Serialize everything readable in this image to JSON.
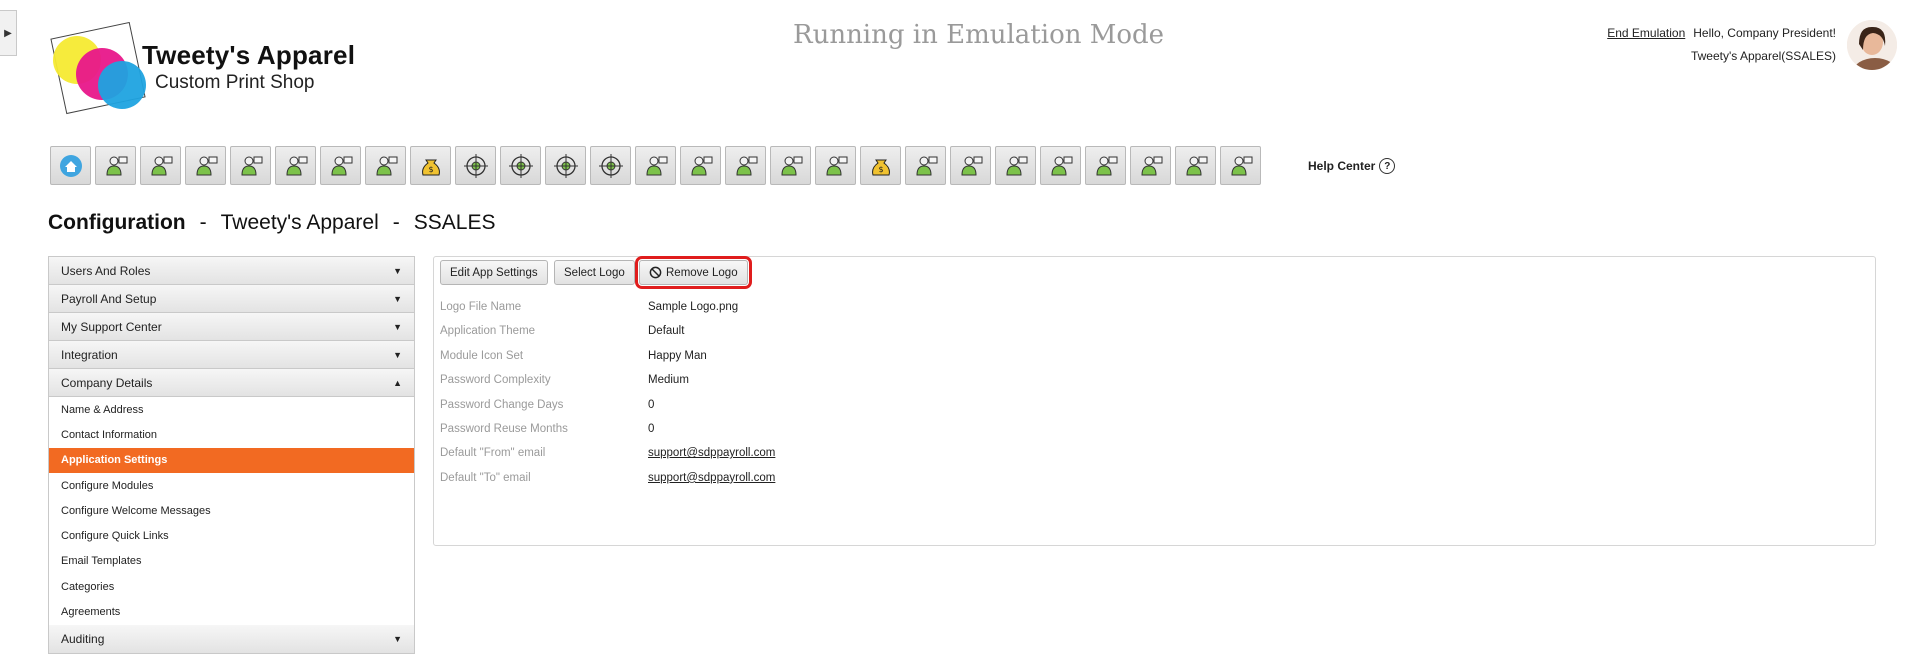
{
  "brand": {
    "name": "Tweety's Apparel",
    "tagline": "Custom Print Shop",
    "colors": {
      "yellow": "#f6ea32",
      "magenta": "#e8178a",
      "cyan": "#1fa3e0"
    }
  },
  "header": {
    "emulation_text": "Running in Emulation Mode",
    "end_emulation": "End Emulation",
    "greeting": "Hello, Company President!",
    "company": "Tweety's Apparel(SSALES)"
  },
  "toolbar": {
    "icons": [
      "home-icon",
      "award-icon",
      "settings-person-icon",
      "presenter-icon",
      "team-icon",
      "group-board-icon",
      "org-chart-icon",
      "document-icon",
      "money-bag-icon",
      "target-icon",
      "target-icon",
      "target-icon",
      "target-icon",
      "team-chart-icon",
      "person-idea-icon",
      "shield-lock-icon",
      "payment-hand-icon",
      "person-cancel-icon",
      "money-bag-icon",
      "team-money-icon",
      "person-idea-icon",
      "network-icon",
      "payment-hand-icon",
      "gift-icon",
      "file-icon",
      "group-board-icon",
      "certificate-icon"
    ],
    "help_label": "Help Center",
    "help_glyph": "?"
  },
  "page_title": {
    "section": "Configuration",
    "sep": "-",
    "company": "Tweety's Apparel",
    "code": "SSALES"
  },
  "menu": {
    "accent": "#f26a22",
    "collapsed_top": [
      {
        "label": "Users And Roles"
      },
      {
        "label": "Payroll And Setup"
      },
      {
        "label": "My Support Center"
      },
      {
        "label": "Integration"
      }
    ],
    "expanded": {
      "label": "Company Details",
      "items": [
        "Name & Address",
        "Contact Information",
        "Application Settings",
        "Configure Modules",
        "Configure Welcome Messages",
        "Configure Quick Links",
        "Email Templates",
        "Categories",
        "Agreements"
      ],
      "active": "Application Settings"
    },
    "collapsed_bottom": [
      {
        "label": "Auditing"
      }
    ]
  },
  "actions": {
    "edit": "Edit App Settings",
    "select": "Select Logo",
    "remove": "Remove Logo"
  },
  "settings": [
    {
      "label": "Logo File Name",
      "value": "Sample Logo.png",
      "link": false
    },
    {
      "label": "Application Theme",
      "value": "Default",
      "link": false
    },
    {
      "label": "Module Icon Set",
      "value": "Happy Man",
      "link": false
    },
    {
      "label": "Password Complexity",
      "value": "Medium",
      "link": false
    },
    {
      "label": "Password Change Days",
      "value": "0",
      "link": false
    },
    {
      "label": "Password Reuse Months",
      "value": "0",
      "link": false
    },
    {
      "label": "Default \"From\" email",
      "value": "support@sdppayroll.com",
      "link": true
    },
    {
      "label": "Default \"To\" email",
      "value": "support@sdppayroll.com",
      "link": true
    }
  ]
}
